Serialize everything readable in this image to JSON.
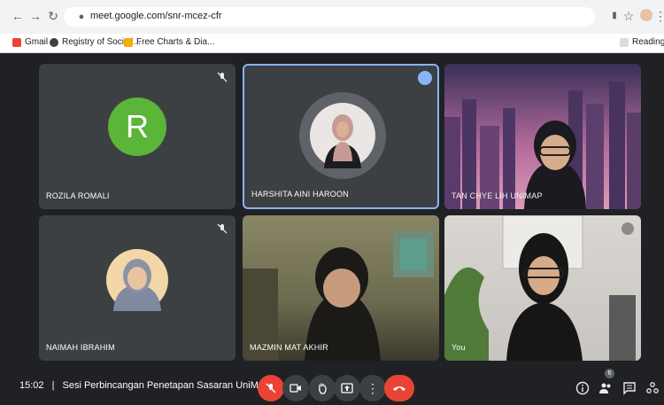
{
  "browser": {
    "url": "meet.google.com/snr-mcez-cfr",
    "bookmarks": [
      "Gmail",
      "Registry of Societi...",
      "Free Charts & Dia..."
    ],
    "reading_list": "Reading List"
  },
  "participants": [
    {
      "name": "ROZILA ROMALI",
      "avatar_letter": "R",
      "muted": true
    },
    {
      "name": "HARSHITA AINI HAROON",
      "speaking": true
    },
    {
      "name": "TAN CHYE LIH UNIMAP"
    },
    {
      "name": "NAIMAH IBRAHIM",
      "muted": true
    },
    {
      "name": "MAZMIN MAT AKHIR"
    },
    {
      "name": "You"
    }
  ],
  "meeting": {
    "time": "15:02",
    "separator": "|",
    "title": "Sesi Perbincangan Penetapan Sasaran UniMA...",
    "participant_count": "6"
  },
  "colors": {
    "accent_blue": "#8ab4f8",
    "end_red": "#ea4335",
    "avatar_green": "#5bb538"
  }
}
